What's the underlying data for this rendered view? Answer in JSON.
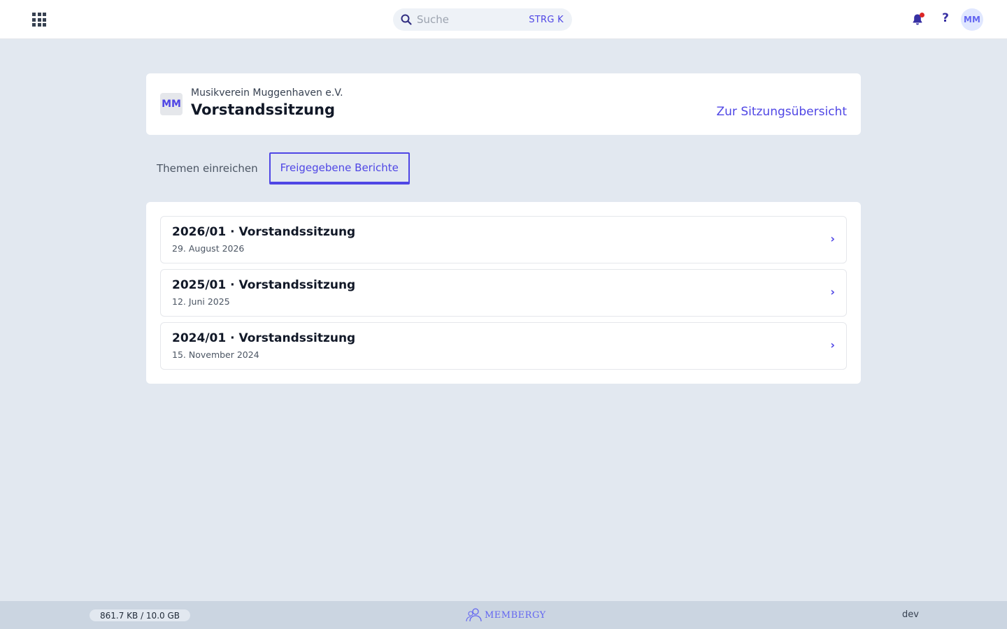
{
  "topbar": {
    "search_placeholder": "Suche",
    "search_shortcut": "STRG K",
    "help_label": "?",
    "user_initials": "MM",
    "has_notification": true
  },
  "header": {
    "org_initials": "MM",
    "org_name": "Musikverein Muggenhaven e.V.",
    "title": "Vorstandssitzung",
    "overview_link": "Zur Sitzungsübersicht"
  },
  "tabs": [
    {
      "label": "Themen einreichen",
      "active": false
    },
    {
      "label": "Freigegebene Berichte",
      "active": true
    }
  ],
  "meetings": [
    {
      "title": "2026/01 · Vorstandssitzung",
      "date": "29. August 2026"
    },
    {
      "title": "2025/01 · Vorstandssitzung",
      "date": "12. Juni 2025"
    },
    {
      "title": "2024/01 · Vorstandssitzung",
      "date": "15. November 2024"
    }
  ],
  "footer": {
    "storage": "861.7 KB / 10.0 GB",
    "brand": "MEMBERGY",
    "environment": "dev"
  },
  "colors": {
    "accent": "#4f46e5",
    "background": "#e2e8f0",
    "notification": "#dc2626"
  }
}
